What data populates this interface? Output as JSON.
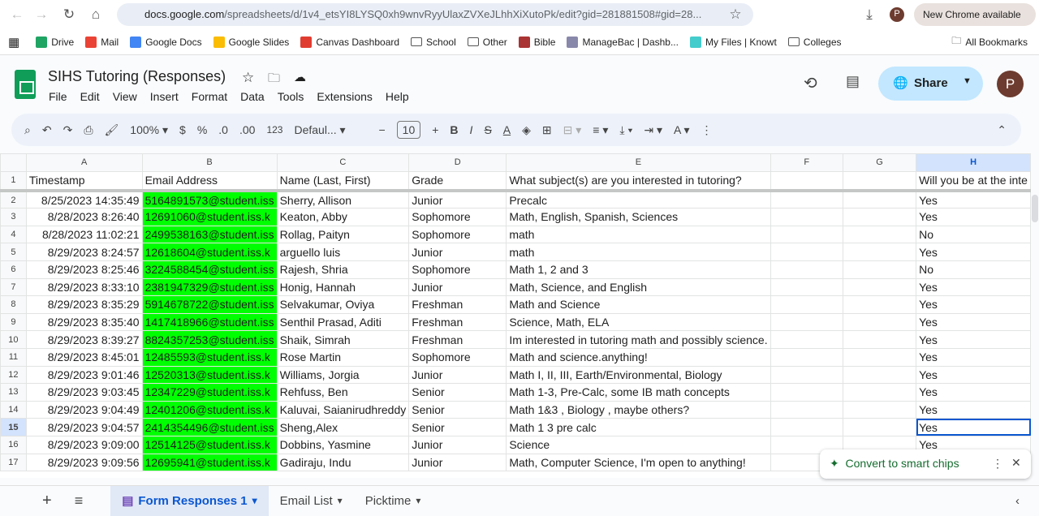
{
  "browser": {
    "url_host": "docs.google.com",
    "url_path": "/spreadsheets/d/1v4_etsYI8LYSQ0xh9wnvRyyUlaxZVXeJLhhXiXutoPk/edit?gid=281881508#gid=28...",
    "new_chrome": "New Chrome available",
    "profile": "P"
  },
  "bookmarks": [
    {
      "label": "Drive",
      "color": "#1fa463"
    },
    {
      "label": "Mail",
      "color": "#ea4335"
    },
    {
      "label": "Google Docs",
      "color": "#4285f4"
    },
    {
      "label": "Google Slides",
      "color": "#fbbc04"
    },
    {
      "label": "Canvas Dashboard",
      "color": "#e13c30"
    },
    {
      "label": "School",
      "color": "folder"
    },
    {
      "label": "Other",
      "color": "folder"
    },
    {
      "label": "Bible",
      "color": "#a33"
    },
    {
      "label": "ManageBac | Dashb...",
      "color": "#88a"
    },
    {
      "label": "My Files | Knowt",
      "color": "#4cc"
    },
    {
      "label": "Colleges",
      "color": "folder"
    }
  ],
  "all_bookmarks": "All Bookmarks",
  "doc": {
    "title": "SIHS Tutoring (Responses)",
    "menus": [
      "File",
      "Edit",
      "View",
      "Insert",
      "Format",
      "Data",
      "Tools",
      "Extensions",
      "Help"
    ],
    "share": "Share",
    "avatar": "P"
  },
  "toolbar": {
    "zoom": "100%",
    "currency": "$",
    "percent": "%",
    "dec_dec": ".0",
    "inc_dec": ".00",
    "format_123": "123",
    "font": "Defaul...",
    "font_size": "10"
  },
  "columns": [
    "A",
    "B",
    "C",
    "D",
    "E",
    "F",
    "G",
    "H"
  ],
  "headers": [
    "Timestamp",
    "Email Address",
    "Name (Last, First)",
    "Grade",
    "What subject(s) are you interested in tutoring?",
    "",
    "",
    "Will you be at the inte"
  ],
  "rows": [
    [
      "8/25/2023 14:35:49",
      "5164891573@student.iss",
      "Sherry, Allison",
      "Junior",
      "Precalc",
      "Yes"
    ],
    [
      "8/28/2023 8:26:40",
      "12691060@student.iss.k",
      "Keaton, Abby",
      "Sophomore",
      "Math, English, Spanish, Sciences",
      "Yes"
    ],
    [
      "8/28/2023 11:02:21",
      "2499538163@student.iss",
      "Rollag, Paityn",
      "Sophomore",
      "math",
      "No"
    ],
    [
      "8/29/2023 8:24:57",
      "12618604@student.iss.k",
      "arguello luis",
      "Junior",
      "math",
      "Yes"
    ],
    [
      "8/29/2023 8:25:46",
      "3224588454@student.iss",
      "Rajesh, Shria",
      "Sophomore",
      "Math 1, 2 and 3",
      "No"
    ],
    [
      "8/29/2023 8:33:10",
      "2381947329@student.iss",
      "Honig, Hannah",
      "Junior",
      "Math, Science, and English",
      "Yes"
    ],
    [
      "8/29/2023 8:35:29",
      "5914678722@student.iss",
      "Selvakumar, Oviya",
      "Freshman",
      "Math and Science",
      "Yes"
    ],
    [
      "8/29/2023 8:35:40",
      "1417418966@student.iss",
      "Senthil Prasad, Aditi",
      "Freshman",
      "Science, Math, ELA",
      "Yes"
    ],
    [
      "8/29/2023 8:39:27",
      "8824357253@student.iss",
      "Shaik, Simrah",
      "Freshman",
      "Im interested in tutoring math and possibly science.",
      "Yes"
    ],
    [
      "8/29/2023 8:45:01",
      "12485593@student.iss.k",
      "Rose Martin",
      "Sophomore",
      "Math and science.anything!",
      "Yes"
    ],
    [
      "8/29/2023 9:01:46",
      "12520313@student.iss.k",
      "Williams, Jorgia",
      "Junior",
      "Math I, II, III, Earth/Environmental, Biology",
      "Yes"
    ],
    [
      "8/29/2023 9:03:45",
      "12347229@student.iss.k",
      "Rehfuss, Ben",
      "Senior",
      "Math 1-3, Pre-Calc, some IB math concepts",
      "Yes"
    ],
    [
      "8/29/2023 9:04:49",
      "12401206@student.iss.k",
      "Kaluvai, Saianirudhreddy",
      "Senior",
      "Math 1&3 , Biology , maybe others?",
      "Yes"
    ],
    [
      "8/29/2023 9:04:57",
      "2414354496@student.iss",
      "Sheng,Alex",
      "Senior",
      "Math 1 3 pre calc",
      "Yes"
    ],
    [
      "8/29/2023 9:09:00",
      "12514125@student.iss.k",
      "Dobbins, Yasmine",
      "Junior",
      "Science",
      "Yes"
    ],
    [
      "8/29/2023 9:09:56",
      "12695941@student.iss.k",
      "Gadiraju, Indu",
      "Junior",
      "Math, Computer Science, I'm open to anything!",
      ""
    ]
  ],
  "highlight_color": "#00ff00",
  "selected_row": 15,
  "chip": {
    "label": "Convert to smart chips"
  },
  "sheets": [
    {
      "label": "Form Responses 1",
      "active": true
    },
    {
      "label": "Email List"
    },
    {
      "label": "Picktime"
    }
  ]
}
